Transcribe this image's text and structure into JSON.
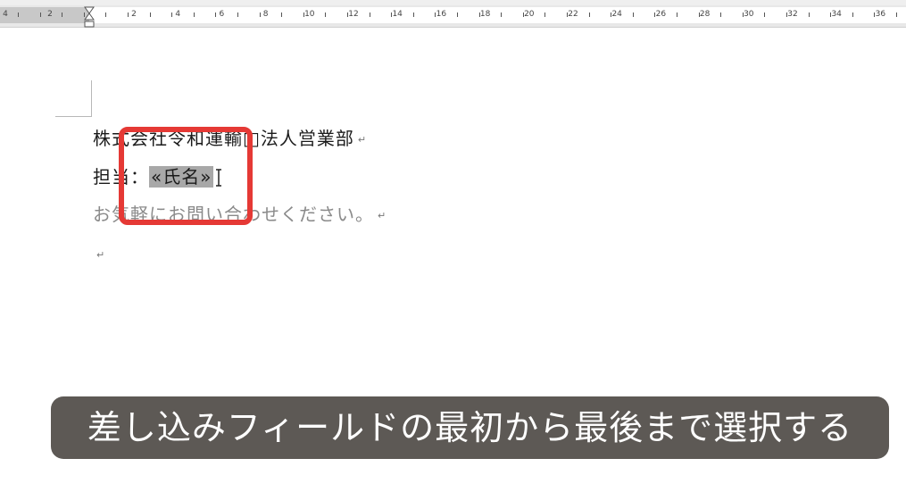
{
  "ruler": {
    "labels": [
      "4",
      "2",
      "2",
      "4",
      "6",
      "8",
      "10",
      "12",
      "14",
      "16",
      "18",
      "20",
      "22",
      "24",
      "26",
      "28",
      "30",
      "32",
      "34",
      "36"
    ]
  },
  "document": {
    "line1": "株式会社令和運輸□法人営業部",
    "line2_prefix": "担当：",
    "line2_field": "«氏名»",
    "line3": "お気軽にお問い合わせください。",
    "para_mark": "↵"
  },
  "caption": "差し込みフィールドの最初から最後まで選択する",
  "colors": {
    "highlight": "#e53935",
    "caption_bg": "#5d5955",
    "field_bg": "#a8a8a8"
  }
}
